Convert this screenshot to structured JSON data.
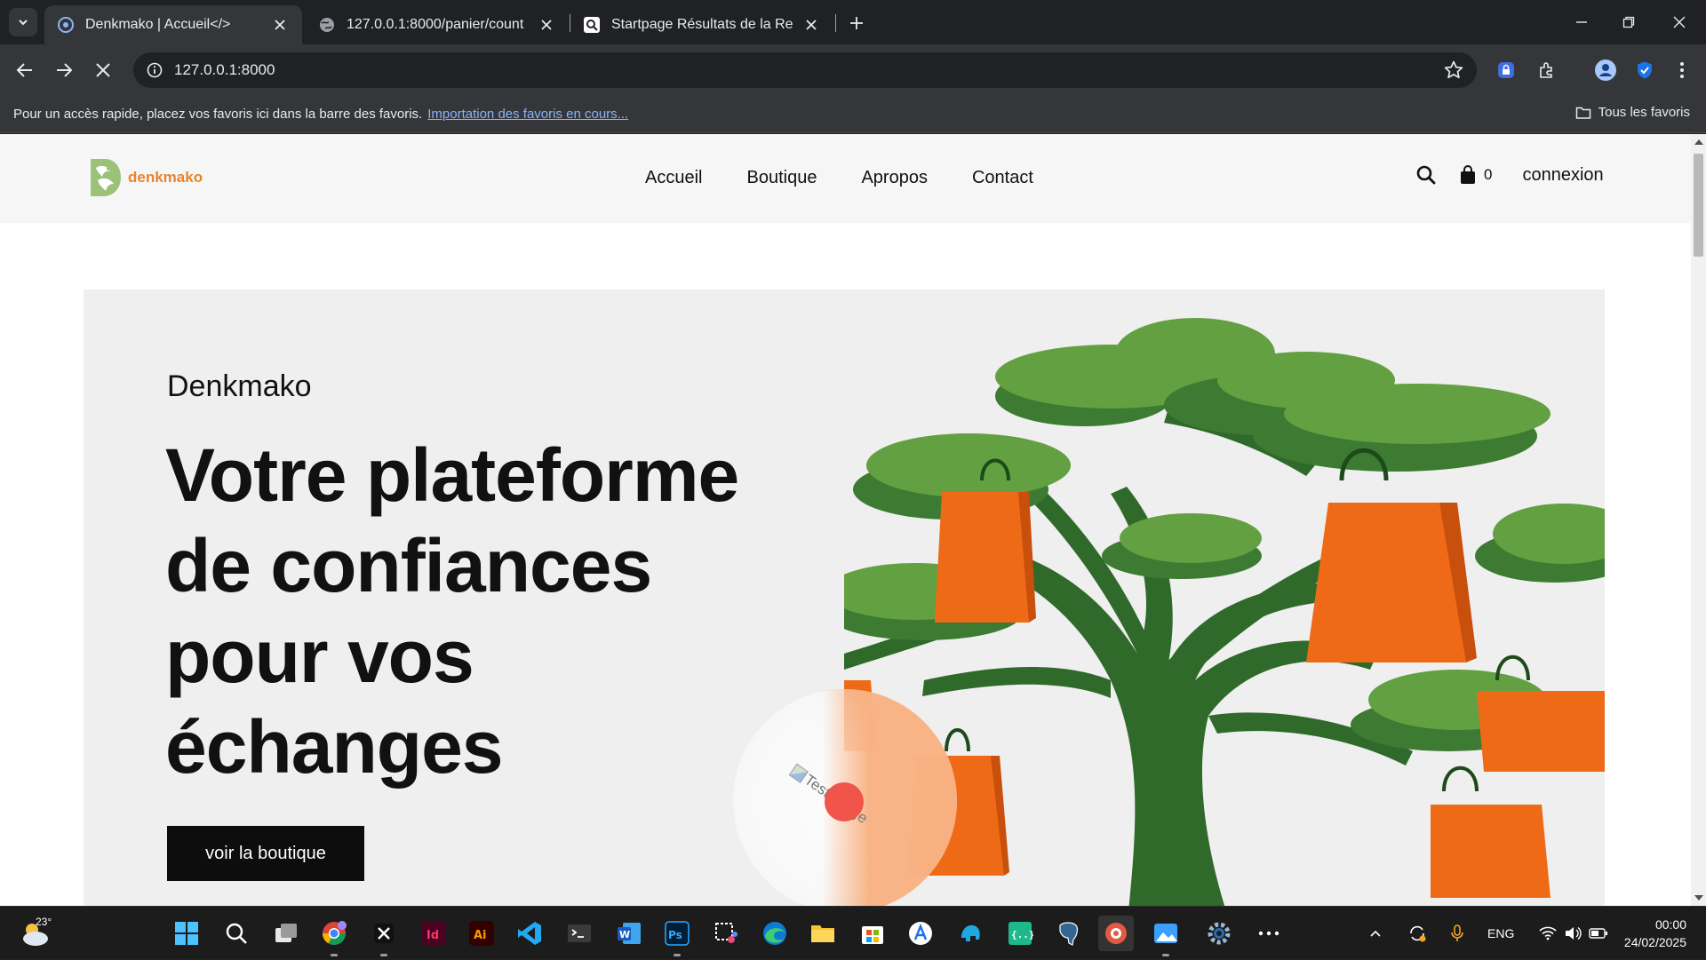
{
  "browser": {
    "tabs": [
      {
        "title": "Denkmako | Accueil</>",
        "active": true
      },
      {
        "title": "127.0.0.1:8000/panier/count",
        "active": false
      },
      {
        "title": "Startpage Résultats de la Recherche",
        "active": false
      }
    ],
    "url": "127.0.0.1:8000",
    "bookmarks_bar": {
      "prompt": "Pour un accès rapide, placez vos favoris ici dans la barre des favoris.",
      "import_link": "Importation des favoris en cours...",
      "all_bookmarks": "Tous les favoris"
    }
  },
  "site": {
    "logo_text": "denkmako",
    "nav": [
      "Accueil",
      "Boutique",
      "Apropos",
      "Contact"
    ],
    "cart_count": "0",
    "login_label": "connexion",
    "hero": {
      "kicker": "Denkmako",
      "title_lines": [
        "Votre plateforme",
        "de confiances",
        "pour vos",
        "échanges"
      ],
      "cta_label": "voir la boutique",
      "broken_image_alt": "Test image"
    }
  },
  "taskbar": {
    "weather_temp": "23°",
    "language": "ENG",
    "time": "00:00",
    "date": "24/02/2025"
  },
  "colors": {
    "brand_orange": "#e8842a",
    "bag_orange": "#ee6a17",
    "tree_dark": "#3d7a32",
    "tree_light": "#63a041",
    "trunk": "#2f6a2a"
  }
}
